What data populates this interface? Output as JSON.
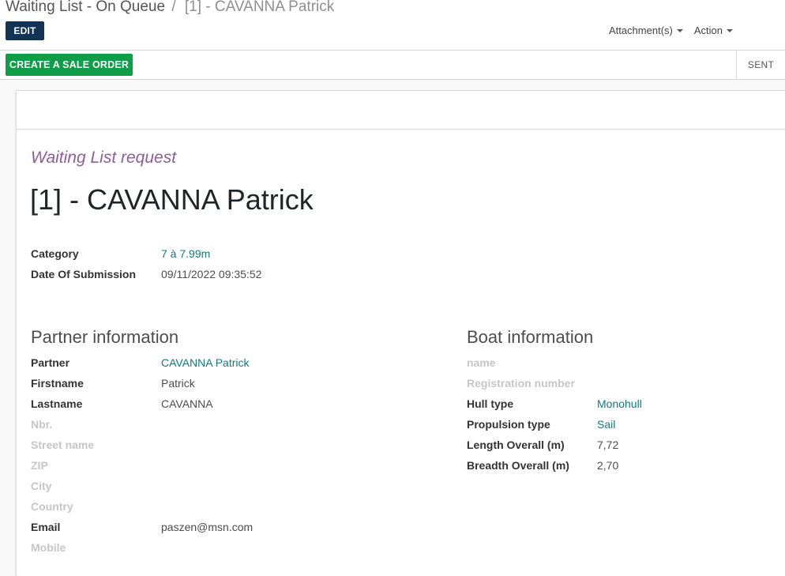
{
  "breadcrumb": {
    "parent": "Waiting List - On Queue",
    "separator": "/",
    "current": "[1] - CAVANNA Patrick"
  },
  "toolbar": {
    "edit_label": "EDIT",
    "attachments_label": "Attachment(s)",
    "action_label": "Action"
  },
  "statusbar": {
    "create_sale_order_label": "CREATE A SALE ORDER",
    "status_label": "SENT"
  },
  "form": {
    "subtitle": "Waiting List request",
    "title": "[1] - CAVANNA Patrick",
    "general": {
      "category_label": "Category",
      "category_value": "7 à 7.99m",
      "date_label": "Date Of Submission",
      "date_value": "09/11/2022 09:35:52"
    },
    "partner": {
      "title": "Partner information",
      "fields": [
        {
          "label": "Partner",
          "value": "CAVANNA Patrick"
        },
        {
          "label": "Firstname",
          "value": "Patrick"
        },
        {
          "label": "Lastname",
          "value": "CAVANNA"
        },
        {
          "label": "Nbr.",
          "value": ""
        },
        {
          "label": "Street name",
          "value": ""
        },
        {
          "label": "ZIP",
          "value": ""
        },
        {
          "label": "City",
          "value": ""
        },
        {
          "label": "Country",
          "value": ""
        },
        {
          "label": "Email",
          "value": "paszen@msn.com"
        },
        {
          "label": "Mobile",
          "value": ""
        }
      ]
    },
    "boat": {
      "title": "Boat information",
      "fields": [
        {
          "label": "name",
          "value": ""
        },
        {
          "label": "Registration number",
          "value": ""
        },
        {
          "label": "Hull type",
          "value": "Monohull"
        },
        {
          "label": "Propulsion type",
          "value": "Sail"
        },
        {
          "label": "Length Overall (m)",
          "value": "7,72"
        },
        {
          "label": "Breadth Overall (m)",
          "value": "2,70"
        }
      ]
    }
  },
  "colors": {
    "edit_button": "#113355",
    "sale_button": "#0f9d48",
    "link": "#107a7f",
    "subtitle": "#8f5b9b"
  }
}
